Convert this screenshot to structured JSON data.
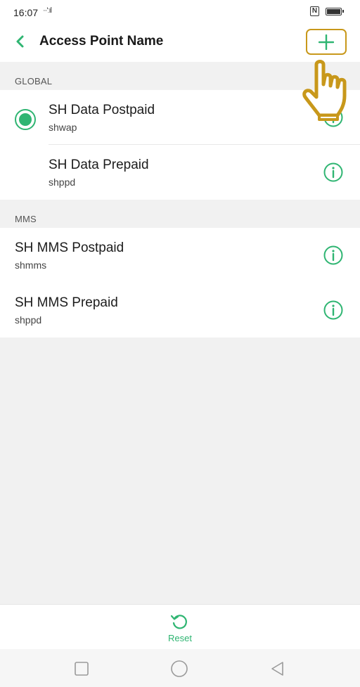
{
  "status_bar": {
    "time": "16:07",
    "signal": "··'ːıl",
    "nfc_label": "N"
  },
  "app_bar": {
    "title": "Access Point Name",
    "back_icon": "chevron-left-icon",
    "add_icon": "plus-icon"
  },
  "sections": [
    {
      "header": "GLOBAL",
      "items": [
        {
          "name": "SH Data Postpaid",
          "apn": "shwap",
          "selected": true
        },
        {
          "name": "SH Data Prepaid",
          "apn": "shppd",
          "selected": false
        }
      ]
    },
    {
      "header": "MMS",
      "items": [
        {
          "name": "SH MMS Postpaid",
          "apn": "shmms"
        },
        {
          "name": "SH MMS Prepaid",
          "apn": "shppd"
        }
      ]
    }
  ],
  "bottom_action": {
    "reset_label": "Reset",
    "icon": "refresh-icon"
  },
  "nav_bar": {
    "icons": [
      "square-recents-icon",
      "circle-home-icon",
      "triangle-back-icon"
    ]
  },
  "colors": {
    "accent": "#2fb572",
    "highlight_box": "#c8981b",
    "background": "#f1f1f1"
  }
}
